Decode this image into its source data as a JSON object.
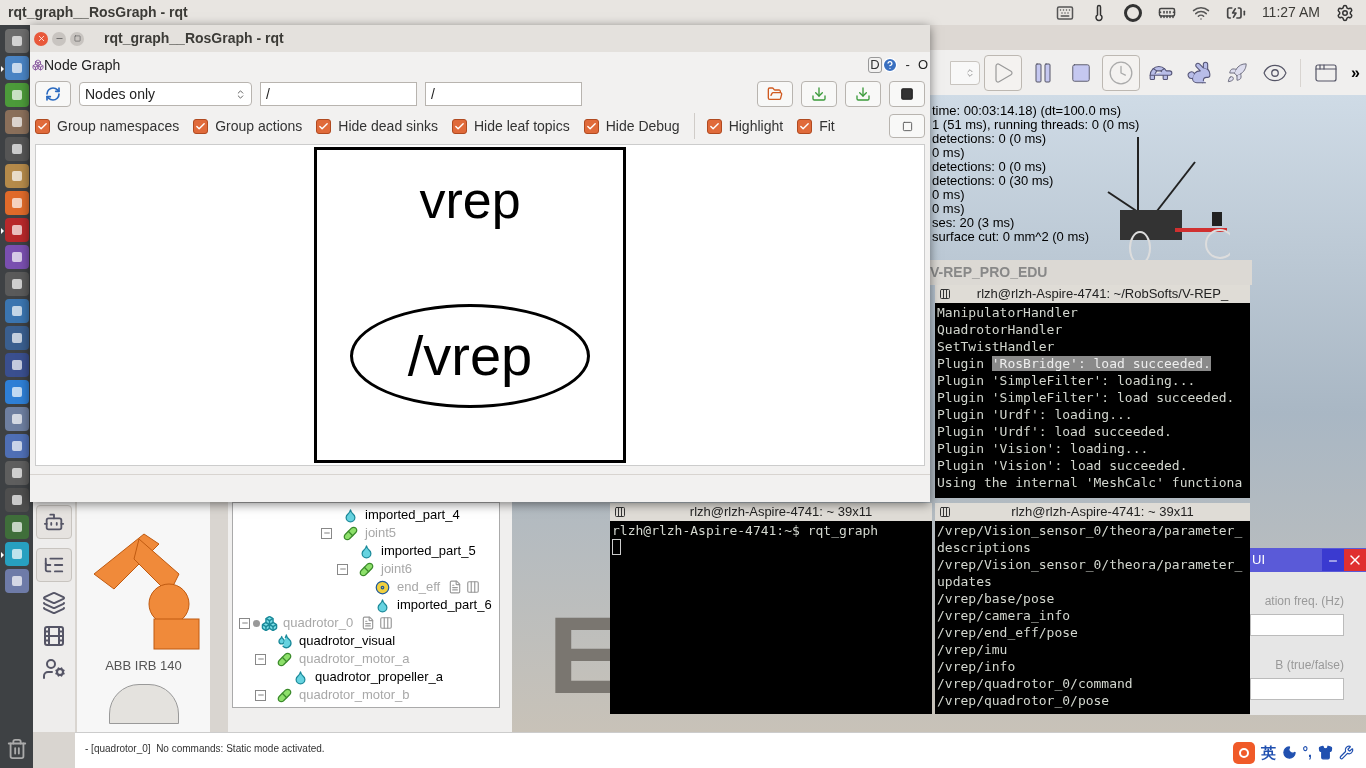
{
  "top_panel": {
    "title": "rqt_graph__RosGraph - rqt",
    "time": "11:27 AM"
  },
  "launcher": [
    {
      "running": false
    },
    {
      "running": true
    },
    {
      "running": false
    },
    {
      "running": false
    },
    {
      "running": false
    },
    {
      "running": false
    },
    {
      "running": false
    },
    {
      "running": true
    },
    {
      "running": false
    },
    {
      "running": false
    },
    {
      "running": false
    },
    {
      "running": false
    },
    {
      "running": false
    },
    {
      "running": false
    },
    {
      "running": false
    },
    {
      "running": false
    },
    {
      "running": false
    },
    {
      "running": false
    },
    {
      "running": false
    },
    {
      "running": true
    },
    {
      "running": false
    }
  ],
  "vrep": {
    "toolbar": [
      {
        "kind": "spin",
        "active": false
      },
      {
        "kind": "play",
        "active": true
      },
      {
        "kind": "pause",
        "active": false
      },
      {
        "kind": "stop",
        "active": false
      },
      {
        "kind": "clock",
        "active": true
      },
      {
        "kind": "turtle",
        "active": false
      },
      {
        "kind": "rabbit",
        "active": false
      },
      {
        "kind": "rocket",
        "active": false
      },
      {
        "kind": "eye",
        "active": false
      },
      {
        "kind": "separator"
      },
      {
        "kind": "windows",
        "active": false
      }
    ],
    "toolbar_more": "»",
    "stats": [
      "time: 00:03:14.18) (dt=100.0 ms)",
      "1 (51 ms), running threads: 0 (0 ms)",
      "detections: 0 (0 ms)",
      "0 ms)",
      "detections: 0 (0 ms)",
      "detections: 0 (30 ms)",
      "0 ms)",
      "0 ms)",
      "ses: 20 (3 ms)",
      "surface cut: 0 mm^2 (0 ms)"
    ],
    "window_title": "V-REP_PRO_EDU",
    "model_browser": [
      {
        "name": "ABB IRB 140"
      }
    ],
    "scene_tree": [
      {
        "kind": "clipped",
        "children": [
          {
            "label": "imported_part_4",
            "kind": "shape",
            "dimmed": false,
            "expanded": false
          },
          {
            "label": "joint5",
            "kind": "joint",
            "dimmed": true,
            "expanded": true,
            "children": [
              {
                "label": "imported_part_5",
                "kind": "shape",
                "dimmed": false,
                "expanded": false
              },
              {
                "label": "joint6",
                "kind": "joint",
                "dimmed": true,
                "expanded": true,
                "children": [
                  {
                    "label": "end_eff",
                    "kind": "dummy",
                    "dimmed": true,
                    "expanded": false,
                    "extras": true
                  },
                  {
                    "label": "imported_part_6",
                    "kind": "shape",
                    "dimmed": false,
                    "expanded": false
                  }
                ]
              }
            ]
          }
        ]
      },
      {
        "label": "quadrotor_0",
        "kind": "group",
        "dimmed": true,
        "expanded": true,
        "extras": true,
        "model": true,
        "children": [
          {
            "label": "quadrotor_visual",
            "kind": "multishape",
            "dimmed": false,
            "expanded": false
          },
          {
            "label": "quadrotor_motor_a",
            "kind": "joint",
            "dimmed": true,
            "expanded": true,
            "children": [
              {
                "label": "quadrotor_propeller_a",
                "kind": "shape",
                "dimmed": false,
                "expanded": false
              }
            ]
          },
          {
            "label": "quadrotor_motor_b",
            "kind": "joint",
            "dimmed": true,
            "expanded": true
          }
        ]
      }
    ],
    "floor_letter": "E",
    "status_message": "- [quadrotor_0]  No commands: Static mode activated."
  },
  "rqt": {
    "title": "rqt_graph__RosGraph - rqt",
    "plugin": "Node Graph",
    "dock_letter": "D",
    "window_controls": [
      "-",
      "O"
    ],
    "mode": "Nodes only",
    "filters": [
      "/",
      "/"
    ],
    "options": [
      {
        "label": "Group namespaces",
        "checked": true
      },
      {
        "label": "Group actions",
        "checked": true
      },
      {
        "label": "Hide dead sinks",
        "checked": true
      },
      {
        "label": "Hide leaf topics",
        "checked": true
      },
      {
        "label": "Hide Debug",
        "checked": true
      },
      {
        "label": "Highlight",
        "checked": true
      },
      {
        "label": "Fit",
        "checked": true
      }
    ],
    "graph": {
      "node": "vrep",
      "topic": "/vrep"
    }
  },
  "terminals": [
    {
      "title": "rlzh@rlzh-Aspire-4741: ~/RobSofts/V-REP_",
      "cursor": false,
      "lines": [
        {
          "text": "ManipulatorHandler"
        },
        {
          "text": "QuadrotorHandler"
        },
        {
          "text": "SetTwistHandler"
        },
        {
          "text": "Plugin ",
          "selection": "'RosBridge': load succeeded."
        },
        {
          "text": "Plugin 'SimpleFilter': loading..."
        },
        {
          "text": "Plugin 'SimpleFilter': load succeeded."
        },
        {
          "text": "Plugin 'Urdf': loading..."
        },
        {
          "text": "Plugin 'Urdf': load succeeded."
        },
        {
          "text": "Plugin 'Vision': loading..."
        },
        {
          "text": "Plugin 'Vision': load succeeded."
        },
        {
          "text": "Using the internal 'MeshCalc' functiona"
        }
      ]
    },
    {
      "title": "rlzh@rlzh-Aspire-4741: ~ 39x11",
      "cursor": true,
      "lines": [
        {
          "text": "rlzh@rlzh-Aspire-4741:~$ rqt_graph"
        }
      ]
    },
    {
      "title": "rlzh@rlzh-Aspire-4741: ~ 39x11",
      "cursor": false,
      "lines": [
        {
          "text": "/vrep/Vision_sensor_0/theora/parameter_"
        },
        {
          "text": "descriptions"
        },
        {
          "text": "/vrep/Vision_sensor_0/theora/parameter_"
        },
        {
          "text": "updates"
        },
        {
          "text": "/vrep/base/pose"
        },
        {
          "text": "/vrep/camera_info"
        },
        {
          "text": "/vrep/end_eff/pose"
        },
        {
          "text": "/vrep/imu"
        },
        {
          "text": "/vrep/info"
        },
        {
          "text": "/vrep/quadrotor_0/command"
        },
        {
          "text": "/vrep/quadrotor_0/pose"
        }
      ]
    }
  ],
  "dialog": {
    "title": "UI",
    "fields": [
      {
        "label": "ation freq. (Hz)"
      },
      {
        "label": "B (true/false)"
      }
    ]
  },
  "ime": {
    "language": "英",
    "punctuation": "°,"
  }
}
